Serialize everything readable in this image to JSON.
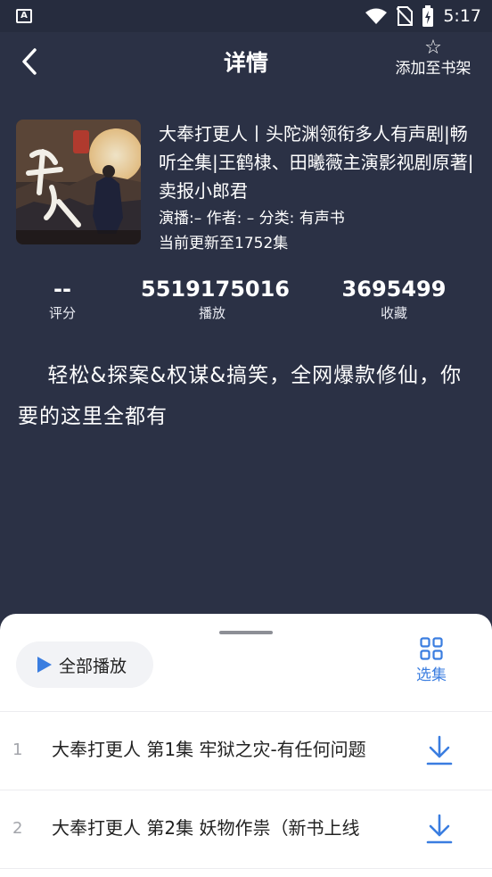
{
  "status": {
    "left_icon": "app-notification-icon",
    "left_glyph": "A",
    "icons": [
      "wifi-icon",
      "no-sim-icon",
      "battery-charging-icon"
    ],
    "time": "5:17"
  },
  "header": {
    "back_icon": "chevron-left-icon",
    "title": "详情",
    "shelf_icon": "star-outline-icon",
    "shelf_label": "添加至书架"
  },
  "book": {
    "cover_icon": "book-cover-image",
    "title": "大奉打更人丨头陀渊领衔多人有声剧|畅听全集|王鹤棣、田曦薇主演影视剧原著|卖报小郎君",
    "meta_line": "演播:–  作者: –  分类: 有声书",
    "update_line": "当前更新至1752集"
  },
  "stats": [
    {
      "value": "--",
      "label": "评分"
    },
    {
      "value": "5519175016",
      "label": "播放"
    },
    {
      "value": "3695499",
      "label": "收藏"
    }
  ],
  "description": "轻松&探案&权谋&搞笑，全网爆款修仙，你要的这里全都有",
  "sheet": {
    "play_all_icon": "play-icon",
    "play_all_label": "全部播放",
    "select_icon": "grid-icon",
    "select_label": "选集",
    "episodes": [
      {
        "number": "1",
        "title": "大奉打更人 第1集 牢狱之灾-有任何问题",
        "download_icon": "download-icon"
      },
      {
        "number": "2",
        "title": "大奉打更人 第2集 妖物作祟（新书上线",
        "download_icon": "download-icon"
      }
    ]
  },
  "colors": {
    "background": "#2b3145",
    "status_bar": "#262c3e",
    "accent": "#3a7de0",
    "sheet": "#ffffff"
  }
}
